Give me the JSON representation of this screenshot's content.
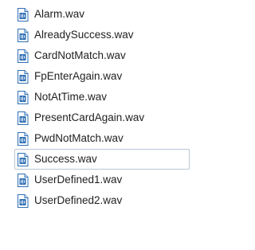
{
  "files": [
    {
      "name": "Alarm.wav",
      "icon": "wav-audio-file-icon"
    },
    {
      "name": "AlreadySuccess.wav",
      "icon": "wav-audio-file-icon"
    },
    {
      "name": "CardNotMatch.wav",
      "icon": "wav-audio-file-icon"
    },
    {
      "name": "FpEnterAgain.wav",
      "icon": "wav-audio-file-icon"
    },
    {
      "name": "NotAtTime.wav",
      "icon": "wav-audio-file-icon"
    },
    {
      "name": "PresentCardAgain.wav",
      "icon": "wav-audio-file-icon"
    },
    {
      "name": "PwdNotMatch.wav",
      "icon": "wav-audio-file-icon"
    },
    {
      "name": "Success.wav",
      "icon": "wav-audio-file-icon",
      "selected": true
    },
    {
      "name": "UserDefined1.wav",
      "icon": "wav-audio-file-icon"
    },
    {
      "name": "UserDefined2.wav",
      "icon": "wav-audio-file-icon"
    }
  ],
  "colors": {
    "icon_blue": "#2f6fb4",
    "selection_border": "#b9c6d3",
    "text": "#1f1f1f"
  }
}
